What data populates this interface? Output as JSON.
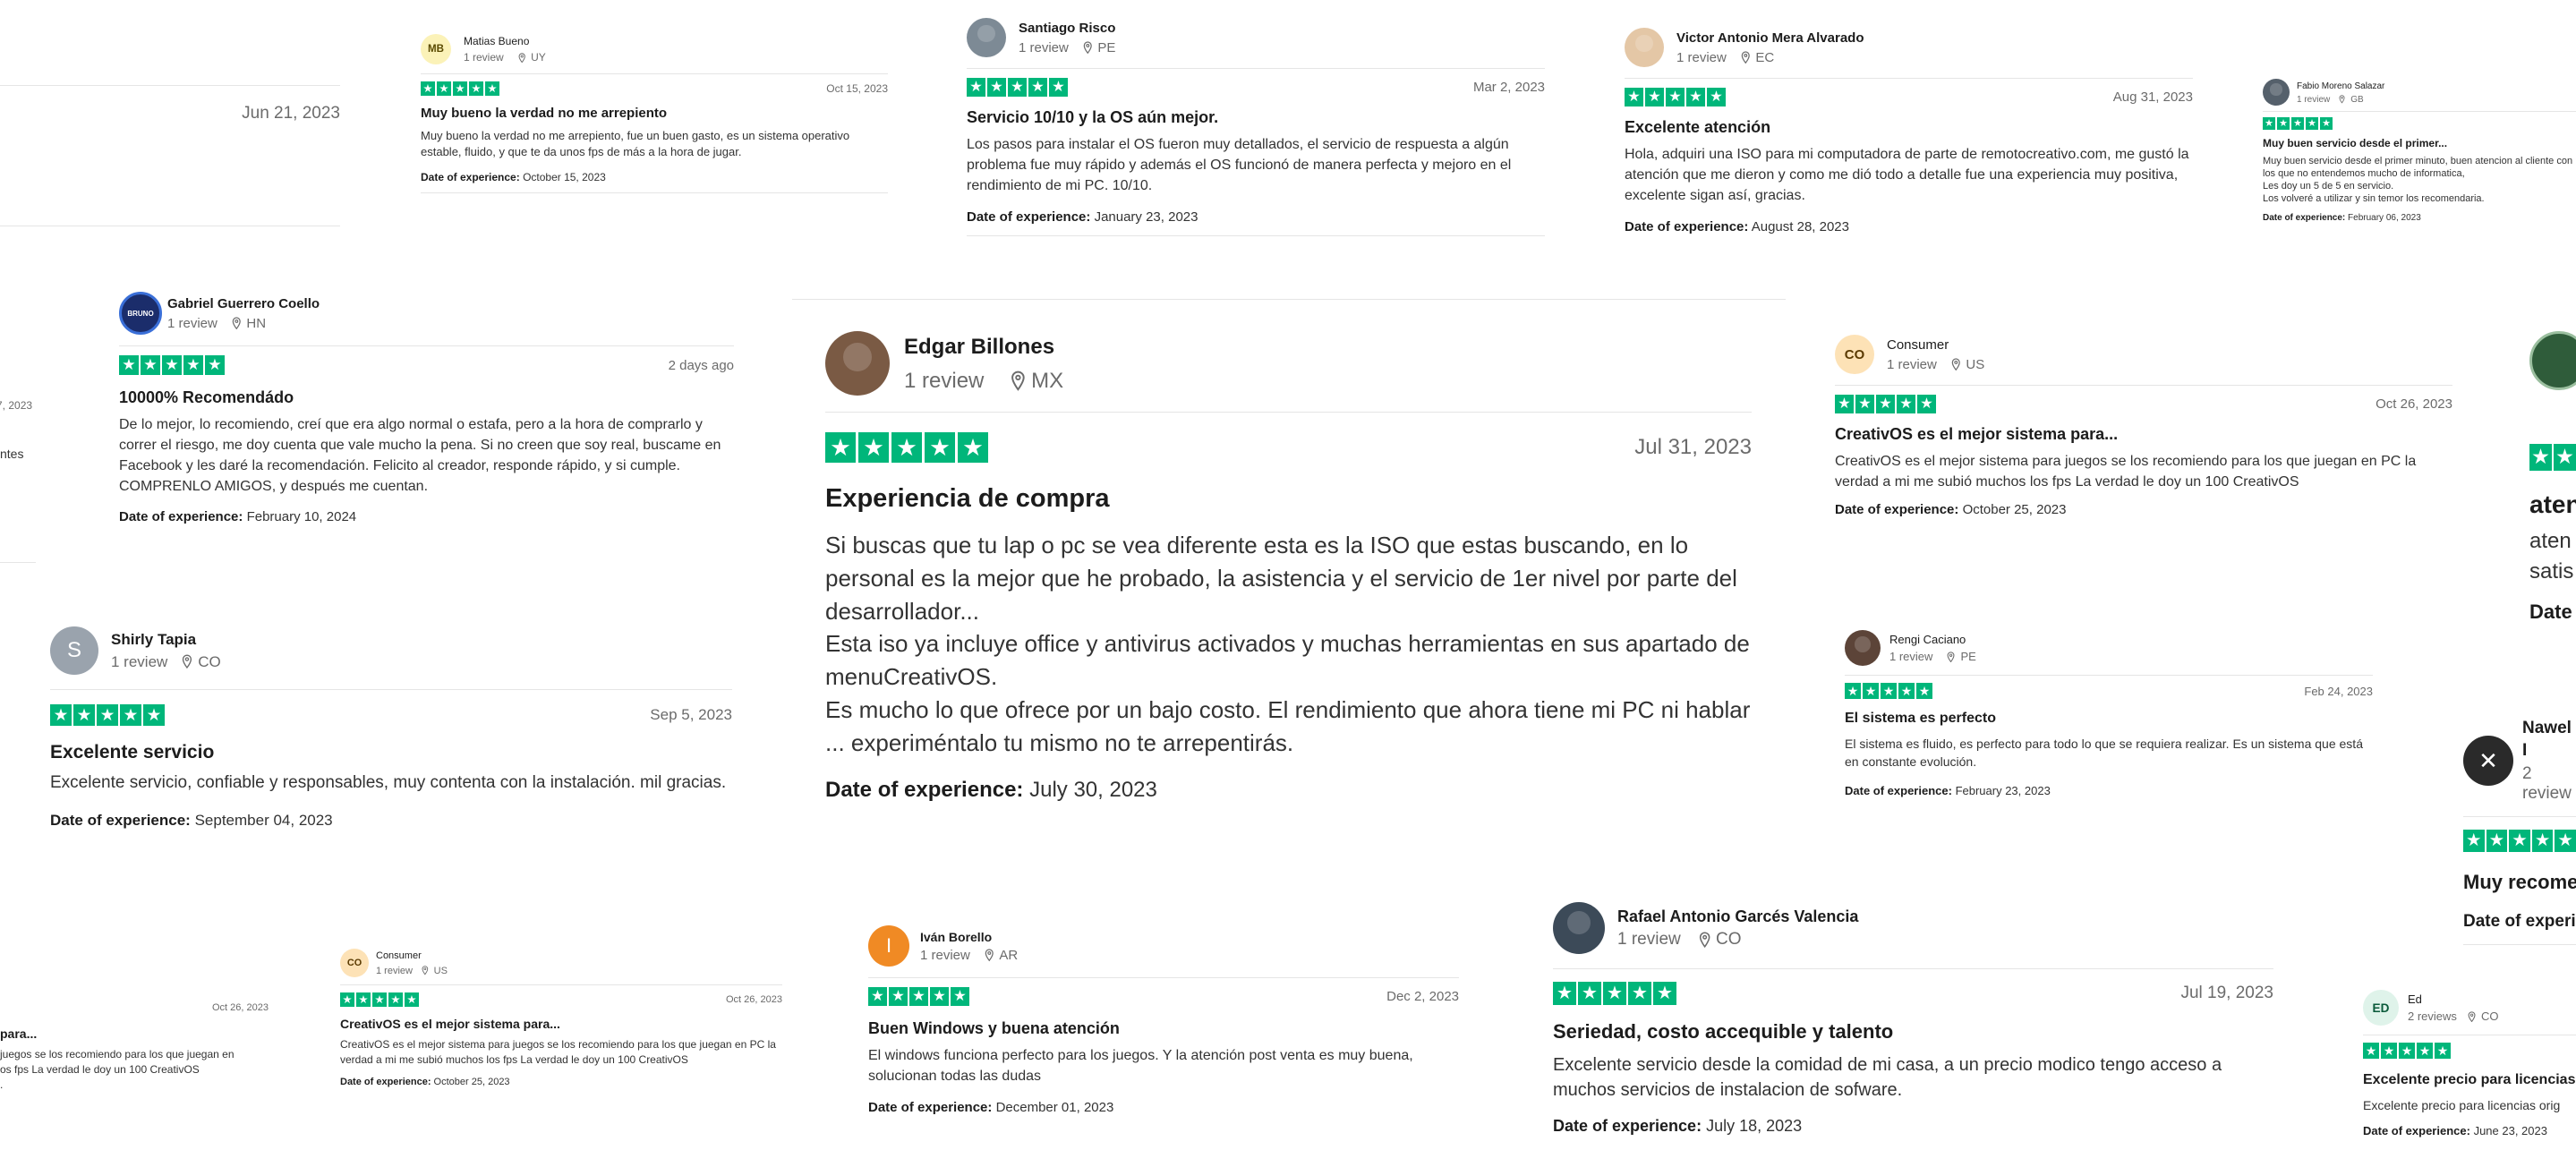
{
  "colors": {
    "star_green": "#00b67a",
    "divider": "#e5e5e5",
    "muted": "#6b6b6b"
  },
  "icons": {
    "rating": "star-icon",
    "location": "location-pin-icon"
  },
  "reviews": [
    {
      "name": "",
      "reviews_count": "",
      "country": "",
      "date": "Jun 21, 2023",
      "title": "",
      "text": "",
      "exp_label": "",
      "exp_date": ""
    },
    {
      "name": "Matias Bueno",
      "avatar_initials": "MB",
      "reviews_count": "1 review",
      "country": "UY",
      "date": "Oct 15, 2023",
      "title": "Muy bueno la verdad no me arrepiento",
      "text": "Muy bueno la verdad no me arrepiento, fue un buen gasto, es un sistema operativo estable, fluido, y que te da unos fps de más a la hora de jugar.",
      "exp_label": "Date of experience:",
      "exp_date": "October 15, 2023"
    },
    {
      "name": "Santiago Risco",
      "avatar_initials": "",
      "reviews_count": "1 review",
      "country": "PE",
      "date": "Mar 2, 2023",
      "title": "Servicio 10/10 y la OS aún mejor.",
      "text": "Los pasos para instalar el OS fueron muy detallados, el servicio de respuesta a algún problema fue muy rápido y además el OS funcionó de manera perfecta y mejoro en el rendimiento de mi PC. 10/10.",
      "exp_label": "Date of experience:",
      "exp_date": "January 23, 2023"
    },
    {
      "name": "Victor Antonio Mera Alvarado",
      "avatar_initials": "",
      "reviews_count": "1 review",
      "country": "EC",
      "date": "Aug 31, 2023",
      "title": "Excelente atención",
      "text": "Hola, adquiri una ISO para mi computadora de parte de remotocreativo.com, me gustó la atención que me dieron y como me dió todo a detalle fue una experiencia muy positiva, excelente sigan así, gracias.",
      "exp_label": "Date of experience:",
      "exp_date": "August 28, 2023"
    },
    {
      "name": "Fabio Moreno Salazar",
      "avatar_initials": "",
      "reviews_count": "1 review",
      "country": "GB",
      "date": "",
      "title": "Muy buen servicio desde el primer...",
      "text": "Muy buen servicio desde el primer minuto, buen atencion al cliente con los que no entendemos mucho de informatica,\nLes doy un 5 de 5 en servicio.\nLos volveré a utilizar y sin temor los recomendaria.",
      "exp_label": "Date of experience:",
      "exp_date": "February 06, 2023"
    },
    {
      "name": "",
      "reviews_count": "",
      "country": "",
      "date": "7, 2023",
      "title": "",
      "text": "ntes",
      "exp_label": "",
      "exp_date": ""
    },
    {
      "name": "Gabriel Guerrero Coello",
      "avatar_initials": "",
      "reviews_count": "1 review",
      "country": "HN",
      "date": "2 days ago",
      "title": "10000% Recomendádo",
      "text": "De lo mejor, lo recomiendo, creí que era algo normal o estafa, pero a la hora de comprarlo y correr el riesgo, me doy cuenta que vale mucho la pena. Si no creen que soy real, buscame en Facebook y les daré la recomendación. Felicito al creador, responde rápido, y si cumple. COMPRENLO AMIGOS, y después me cuentan.",
      "exp_label": "Date of experience:",
      "exp_date": "February 10, 2024"
    },
    {
      "name": "Edgar Billones",
      "avatar_initials": "",
      "reviews_count": "1 review",
      "country": "MX",
      "date": "Jul 31, 2023",
      "title": "Experiencia de compra",
      "text": "Si buscas que tu lap o pc se vea diferente esta es la ISO que estas buscando, en lo personal es la mejor que he probado, la asistencia y el servicio de 1er nivel por parte del desarrollador...\nEsta iso ya incluye office y antivirus activados y muchas herramientas en sus apartado de menuCreativOS.\nEs mucho lo que ofrece por un bajo costo. El rendimiento que ahora tiene mi PC ni hablar ... experiméntalo tu mismo no te arrepentirás.",
      "exp_label": "Date of experience:",
      "exp_date": "July 30, 2023"
    },
    {
      "name": "Consumer",
      "avatar_initials": "CO",
      "reviews_count": "1 review",
      "country": "US",
      "date": "Oct 26, 2023",
      "title": "CreativOS es el mejor sistema para...",
      "text": "CreativOS es el mejor sistema para juegos se los recomiendo para los que juegan en PC la verdad a mi me subió muchos los fps La verdad le doy un 100 CreativOS",
      "exp_label": "Date of experience:",
      "exp_date": "October 25, 2023"
    },
    {
      "name": "",
      "reviews_count": "",
      "country": "",
      "date": "",
      "title": "aten",
      "text": "aten\nsatis",
      "exp_label": "Date",
      "exp_date": ""
    },
    {
      "name": "Shirly Tapia",
      "avatar_initials": "S",
      "reviews_count": "1 review",
      "country": "CO",
      "date": "Sep 5, 2023",
      "title": "Excelente servicio",
      "text": "Excelente servicio, confiable y responsables, muy contenta con la instalación. mil gracias.",
      "exp_label": "Date of experience:",
      "exp_date": "September 04, 2023"
    },
    {
      "name": "Rengi Caciano",
      "avatar_initials": "",
      "reviews_count": "1 review",
      "country": "PE",
      "date": "Feb 24, 2023",
      "title": "El sistema es perfecto",
      "text": "El sistema es fluido, es perfecto para todo lo que se requiera realizar. Es un sistema que está en constante evolución.",
      "exp_label": "Date of experience:",
      "exp_date": "February 23, 2023"
    },
    {
      "name": "Nawel I",
      "avatar_initials": "",
      "reviews_count": "2 review",
      "country": "",
      "date": "",
      "title": "Muy recome",
      "text": "",
      "exp_label": "Date of experie",
      "exp_date": ""
    },
    {
      "name": "",
      "reviews_count": "",
      "country": "",
      "date": "Oct 26, 2023",
      "title": "para...",
      "text": "juegos se los recomiendo para los que juegan en\nos fps La verdad le doy un 100 CreativOS\n.",
      "exp_label": "",
      "exp_date": ""
    },
    {
      "name": "Consumer",
      "avatar_initials": "CO",
      "reviews_count": "1 review",
      "country": "US",
      "date": "Oct 26, 2023",
      "title": "CreativOS es el mejor sistema para...",
      "text": "CreativOS es el mejor sistema para juegos se los recomiendo para los que juegan en PC la verdad a mi me subió muchos los fps La verdad le doy un 100 CreativOS",
      "exp_label": "Date of experience:",
      "exp_date": "October 25, 2023"
    },
    {
      "name": "Iván Borello",
      "avatar_initials": "I",
      "reviews_count": "1 review",
      "country": "AR",
      "date": "Dec 2, 2023",
      "title": "Buen Windows y buena atención",
      "text": "El windows funciona perfecto para los juegos. Y la atención post venta es muy buena, solucionan todas las dudas",
      "exp_label": "Date of experience:",
      "exp_date": "December 01, 2023"
    },
    {
      "name": "Rafael Antonio Garcés Valencia",
      "avatar_initials": "",
      "reviews_count": "1 review",
      "country": "CO",
      "date": "Jul 19, 2023",
      "title": "Seriedad, costo accequible y talento",
      "text": "Excelente servicio desde la comidad de mi casa, a un precio modico tengo acceso a muchos servicios de instalacion de sofware.",
      "exp_label": "Date of experience:",
      "exp_date": "July 18, 2023"
    },
    {
      "name": "Ed",
      "avatar_initials": "ED",
      "reviews_count": "2 reviews",
      "country": "CO",
      "date": "",
      "title": "Excelente precio para licencias",
      "text": "Excelente precio para licencias orig",
      "exp_label": "Date of experience:",
      "exp_date": "June 23, 2023"
    }
  ]
}
